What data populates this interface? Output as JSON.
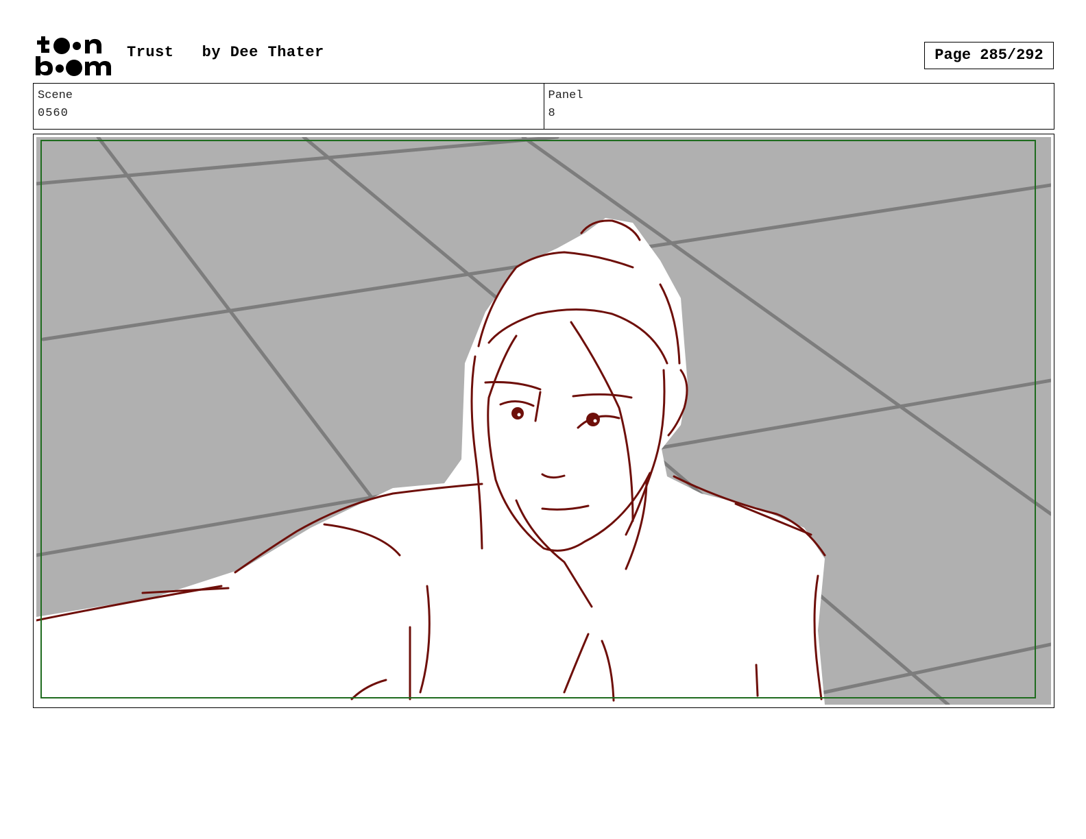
{
  "header": {
    "logo_text": "toon boom",
    "title": "Trust   by Dee Thater",
    "page": "Page 285/292"
  },
  "info": {
    "scene_label": "Scene",
    "scene_value": "0560",
    "panel_label": "Panel",
    "panel_value": "8"
  },
  "colors": {
    "sketch_line": "#6e0f0a",
    "safe_frame": "#1e6b1e",
    "floor_fill": "#b0b0b0",
    "tile_lines": "#7d7d7d"
  }
}
